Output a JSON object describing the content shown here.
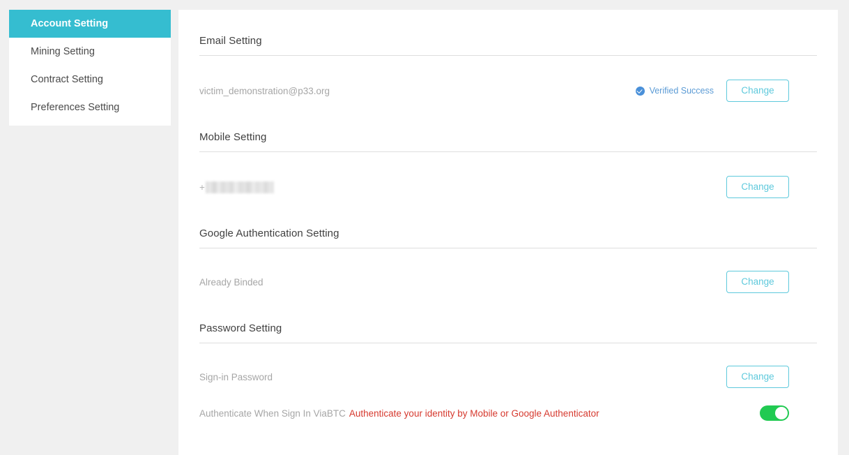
{
  "sidebar": {
    "items": [
      {
        "label": "Account Setting",
        "active": true
      },
      {
        "label": "Mining Setting",
        "active": false
      },
      {
        "label": "Contract Setting",
        "active": false
      },
      {
        "label": "Preferences Setting",
        "active": false
      }
    ]
  },
  "colors": {
    "accent_teal": "#35bdd0",
    "button_border": "#5ec9dc",
    "verified_blue": "#5b9bd5",
    "check_icon_blue": "#4a90d9",
    "warning_red": "#d6392e",
    "toggle_on_green": "#21ca52",
    "page_background": "#f0f0f0",
    "panel_background": "#ffffff",
    "muted_text": "#a6a6a6"
  },
  "sections": {
    "email": {
      "title": "Email Setting",
      "value": "victim_demonstration@p33.org",
      "status": "Verified Success",
      "status_icon": "check-circle-icon",
      "change_label": "Change"
    },
    "mobile": {
      "title": "Mobile Setting",
      "value_prefix": "+",
      "value_masked": "",
      "change_label": "Change"
    },
    "google_auth": {
      "title": "Google Authentication Setting",
      "value": "Already Binded",
      "change_label": "Change"
    },
    "password": {
      "title": "Password Setting",
      "signin_label": "Sign-in Password",
      "change_label": "Change",
      "auth_label": "Authenticate When Sign In ViaBTC",
      "auth_warning": "Authenticate your identity by Mobile or Google Authenticator",
      "auth_toggle_state": "on"
    }
  }
}
